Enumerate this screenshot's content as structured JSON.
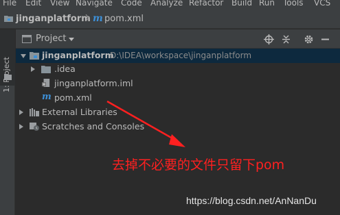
{
  "menu": {
    "items": [
      "File",
      "Edit",
      "View",
      "Navigate",
      "Code",
      "Analyze",
      "Refactor",
      "Build",
      "Run",
      "Tools",
      "VCS"
    ]
  },
  "navbar": {
    "project": "jinganplatform",
    "file": "pom.xml",
    "maven_icon": "m"
  },
  "strip": {
    "tab_label": "1: Project"
  },
  "panel": {
    "title": "Project",
    "tools": [
      "locate-icon",
      "collapse-icon",
      "gear-icon",
      "hide-icon"
    ]
  },
  "tree": {
    "root": {
      "label": "jinganplatform",
      "path": "D:\\IDEA\\workspace\\jinganplatform"
    },
    "idea": {
      "label": ".idea"
    },
    "iml": {
      "label": "jinganplatform.iml"
    },
    "pom": {
      "label": "pom.xml"
    },
    "external": {
      "label": "External Libraries"
    },
    "scratches": {
      "label": "Scratches and Consoles"
    }
  },
  "annotation": {
    "text": "去掉不必要的文件只留下pom",
    "color": "#ff2020"
  },
  "watermark": "https://blog.csdn.net/AnNanDu",
  "colors": {
    "background": "#2b2b2b",
    "panel": "#3c3f41",
    "selection": "#0d293e",
    "folder": "#87939a",
    "maven": "#3d8fd6"
  }
}
